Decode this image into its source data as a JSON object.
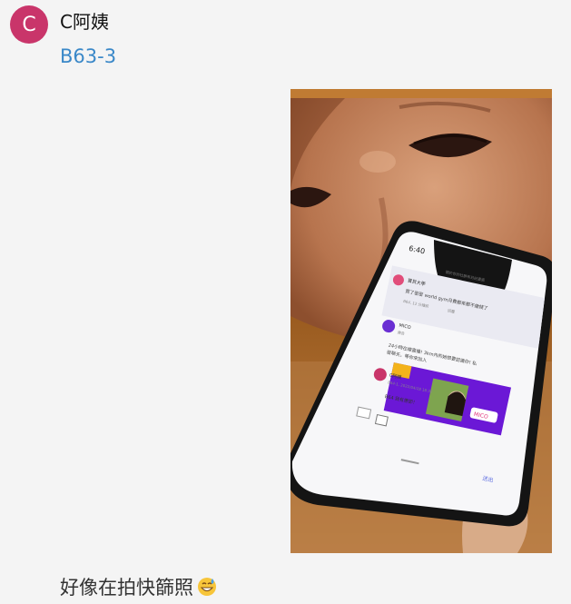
{
  "post": {
    "avatar_letter": "C",
    "username": "C阿姨",
    "reply_ref": "B63-3",
    "caption": "好像在拍快篩照",
    "emoji": "grinning-sweat-emoji"
  },
  "photo": {
    "phone_time": "6:40",
    "phone_url": "關於你的社群有日記畫面",
    "post_author": "寶貝大學",
    "post_text": "買了密密 world gym月費都來都不繳錢了",
    "post_meta": "B64, 12 分鐘前",
    "post_reply": "回覆",
    "mico_name": "MICO",
    "mico_tag": "廣告",
    "mico_text_1": "24小時在線直播! 3km內的她想要認識你! 私",
    "mico_text_2": "密聊天，等你來加入",
    "mico_logo": "MICO",
    "reply_name": "C阿姨",
    "reply_meta": "B64-1, 2022/04/28 18:38",
    "reply_text": "B64 我有應即！",
    "send_label": "送出"
  }
}
